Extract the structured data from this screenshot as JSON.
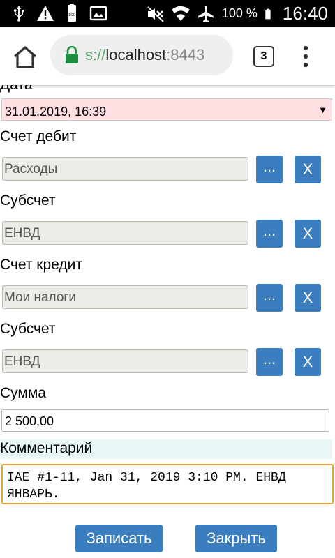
{
  "status_bar": {
    "battery_percent": "100 %",
    "time": "16:40",
    "icons": [
      "usb-icon",
      "warning-icon",
      "battery-small-icon",
      "image-icon",
      "mute-icon",
      "wifi-icon",
      "airplane-icon",
      "battery-icon"
    ]
  },
  "browser": {
    "url_scheme_fragment": "s://",
    "url_host": "localhost",
    "url_port": ":8443",
    "tab_count": "3"
  },
  "form": {
    "date_label": "Дата",
    "date_value": "31.01.2019, 16:39",
    "debit_label": "Счет дебит",
    "debit_value": "Расходы",
    "debit_sub_label": "Субсчет",
    "debit_sub_value": "ЕНВД",
    "credit_label": "Счет кредит",
    "credit_value": "Мои налоги",
    "credit_sub_label": "Субсчет",
    "credit_sub_value": "ЕНВД",
    "pick_label": "...",
    "clear_label": "X",
    "sum_label": "Сумма",
    "sum_value": "2 500,00",
    "comment_label": "Комментарий",
    "comment_value": "IAE #1-11, Jan 31, 2019 3:10 PM. ЕНВД\nЯНВАРЬ."
  },
  "actions": {
    "save_label": "Записать",
    "close_label": "Закрыть"
  },
  "colors": {
    "accent_button": "#3a7ebf",
    "date_field_bg": "#ffdfe2",
    "comment_label_bg": "#eaf7f9",
    "comment_focus_border": "#e5a43a"
  }
}
